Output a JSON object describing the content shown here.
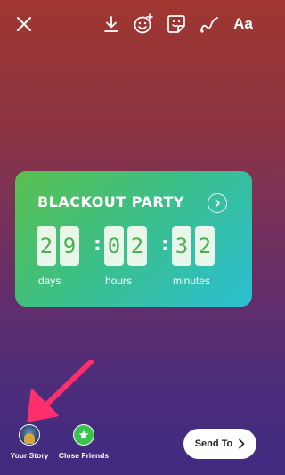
{
  "topbar": {
    "close_icon": "close-icon",
    "download_icon": "download-icon",
    "effects_icon": "face-effects-icon",
    "sticker_icon": "sticker-icon",
    "draw_icon": "draw-icon",
    "text_label": "Aa"
  },
  "countdown": {
    "title": "BLACKOUT PARTY",
    "digits": [
      "2",
      "9",
      "0",
      "2",
      "3",
      "2"
    ],
    "units": [
      "days",
      "hours",
      "minutes"
    ],
    "gradient_colors": [
      "#5bc04f",
      "#2bbfd4"
    ]
  },
  "share": {
    "your_story": "Your Story",
    "close_friends": "Close Friends",
    "send_to": "Send To",
    "accent_green": "#3bc34f"
  },
  "annotation": {
    "pointer_color": "#ff2f6d"
  }
}
